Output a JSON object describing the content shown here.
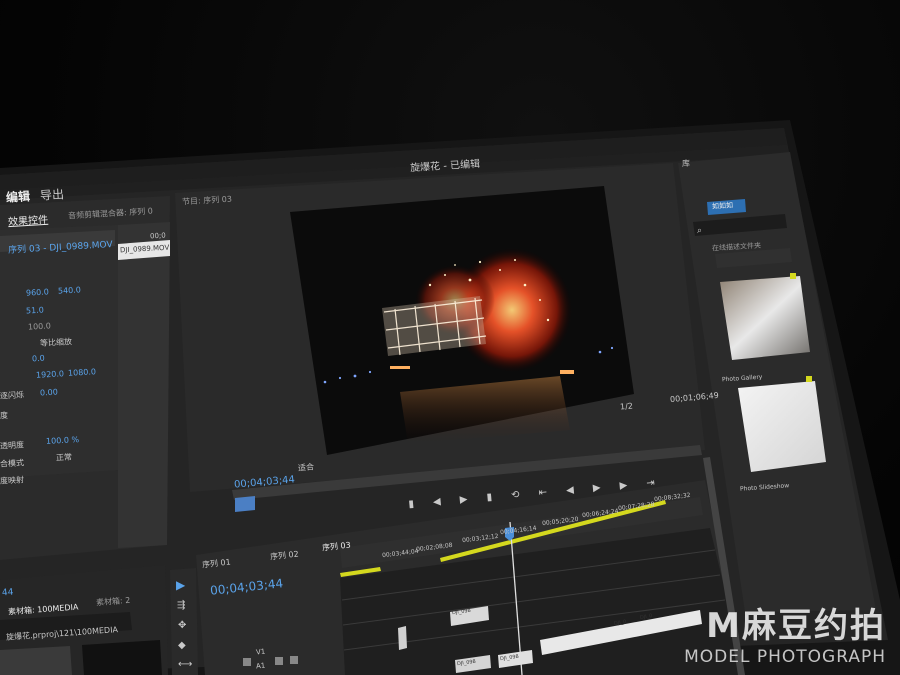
{
  "app": {
    "title": "旋爆花 - 已编辑",
    "tabs": [
      "编辑",
      "导出"
    ],
    "menu_icon": "hamburger-icon",
    "window_icons": [
      "export-icon",
      "share-icon",
      "expand-icon"
    ]
  },
  "effect_controls": {
    "tab_active": "效果控件",
    "tab_inactive": "音频剪辑混合器: 序列 0",
    "clip_label": "序列 03 - DJI_0989.MOV",
    "tooltip": "DJI_0989.MOV",
    "time_prefix": "00;0",
    "rows": [
      {
        "label": "",
        "v1": "960.0",
        "v2": "540.0"
      },
      {
        "label": "",
        "v1": "51.0",
        "v2": ""
      },
      {
        "label": "",
        "v1": "100.0",
        "v2": ""
      },
      {
        "label": "",
        "v1": "等比缩放",
        "v2": ""
      },
      {
        "label": "",
        "v1": "0.0",
        "v2": ""
      },
      {
        "label": "",
        "v1": "1920.0",
        "v2": "1080.0"
      },
      {
        "label": "逐闪烁",
        "v1": "0.00",
        "v2": ""
      },
      {
        "label": "度",
        "v1": "",
        "v2": ""
      },
      {
        "label": "透明度",
        "v1": "100.0 %",
        "v2": ""
      },
      {
        "label": "合模式",
        "v1": "正常",
        "v2": ""
      },
      {
        "label": "度映射",
        "v1": "",
        "v2": ""
      }
    ]
  },
  "program": {
    "title": "节目: 序列 03",
    "timecode": "00;04;03;44",
    "fit": "适合",
    "zoom": "1/2",
    "duration": "00;01;06;49"
  },
  "library": {
    "title": "库",
    "tabs": [
      "",
      ""
    ],
    "search_value": "如如如",
    "filter_label": "在线描述文件夹",
    "items": [
      {
        "name": "Photo Gallery"
      },
      {
        "name": "Photo Slideshow"
      }
    ]
  },
  "project": {
    "tc": "44",
    "bin_label": "素材箱: 100MEDIA",
    "bin2_label": "素材箱: 2",
    "path": "旋爆花.prproj\\121\\100MEDIA"
  },
  "timeline": {
    "tabs": [
      "序列 01",
      "序列 02",
      "序列 03"
    ],
    "timecode": "00;04;03;44",
    "ruler": [
      "00;03;44;04",
      "00;02;08;08",
      "00;03;12;12",
      "00;04;16;14",
      "00;05;20;20",
      "00;06;24;24",
      "00;07;28;28",
      "00;08;32;32"
    ],
    "clip_labels": [
      "DJI_098",
      "DJI_0",
      "DJI_0",
      "DJI_098",
      "DJI_098"
    ],
    "track_labels": [
      "V1",
      "A1",
      "A2"
    ]
  },
  "watermark": {
    "main": "M麻豆约拍",
    "sub": "MODEL PHOTOGRAPH"
  },
  "colors": {
    "panel": "#2b2b2b",
    "accent_blue": "#2f8bd8",
    "timecode_blue": "#5aa3ea",
    "yellow": "#d4d81e",
    "bezel": "#1a1a1a"
  }
}
